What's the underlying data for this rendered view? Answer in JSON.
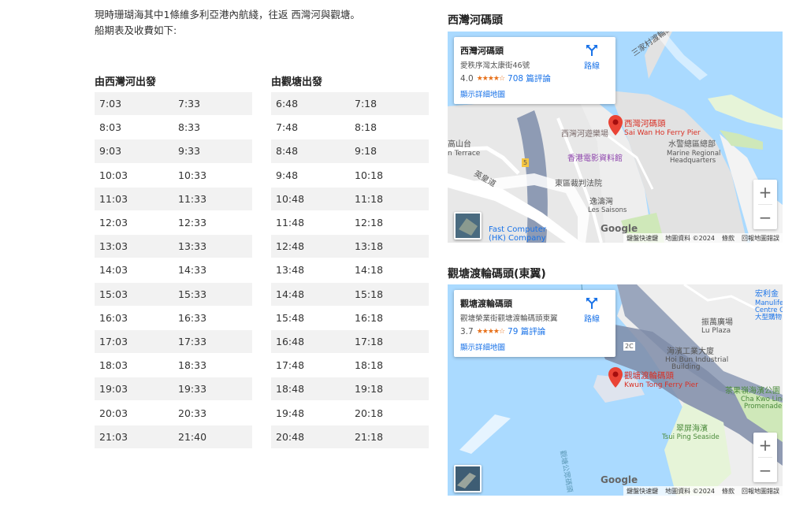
{
  "intro": {
    "line1": "現時珊瑚海其中1條維多利亞港內航綫，往返 西灣河與觀塘。",
    "line2": "船期表及收費如下:"
  },
  "schedule": {
    "from_sai_wan_ho": {
      "title": "由西灣河出發",
      "rows": [
        [
          "7:03",
          "7:33"
        ],
        [
          "8:03",
          "8:33"
        ],
        [
          "9:03",
          "9:33"
        ],
        [
          "10:03",
          "10:33"
        ],
        [
          "11:03",
          "11:33"
        ],
        [
          "12:03",
          "12:33"
        ],
        [
          "13:03",
          "13:33"
        ],
        [
          "14:03",
          "14:33"
        ],
        [
          "15:03",
          "15:33"
        ],
        [
          "16:03",
          "16:33"
        ],
        [
          "17:03",
          "17:33"
        ],
        [
          "18:03",
          "18:33"
        ],
        [
          "19:03",
          "19:33"
        ],
        [
          "20:03",
          "20:33"
        ],
        [
          "21:03",
          "21:40"
        ]
      ]
    },
    "from_kwun_tong": {
      "title": "由觀塘出發",
      "rows": [
        [
          "6:48",
          "7:18"
        ],
        [
          "7:48",
          "8:18"
        ],
        [
          "8:48",
          "9:18"
        ],
        [
          "9:48",
          "10:18"
        ],
        [
          "10:48",
          "11:18"
        ],
        [
          "11:48",
          "12:18"
        ],
        [
          "12:48",
          "13:18"
        ],
        [
          "13:48",
          "14:18"
        ],
        [
          "14:48",
          "15:18"
        ],
        [
          "15:48",
          "16:18"
        ],
        [
          "16:48",
          "17:18"
        ],
        [
          "17:48",
          "18:18"
        ],
        [
          "18:48",
          "19:18"
        ],
        [
          "19:48",
          "20:18"
        ],
        [
          "20:48",
          "21:18"
        ]
      ]
    }
  },
  "map1": {
    "heading": "西灣河碼頭",
    "card": {
      "name": "西灣河碼頭",
      "address": "愛秩序灣太康街46號",
      "rating": "4.0",
      "stars": "★★★★☆",
      "reviews": "708 篇評論",
      "larger_map": "顯示詳細地圖",
      "directions": "路線"
    },
    "labels": {
      "pier_zh": "西灣河碼頭",
      "pier_en": "Sai Wan Ho Ferry Pier",
      "marine_zh": "水警總區總部",
      "marine_en1": "Marine Regional",
      "marine_en2": "Headquarters",
      "playground": "西灣河遊樂場",
      "film_archive": "香港電影資料館",
      "court": "東區裁判法院",
      "les_saisons_zh": "逸濤灣",
      "les_saisons_en": "Les Saisons",
      "fast_computer_1": "Fast Computer",
      "fast_computer_2": "(HK) Company",
      "kwong_ming": "高山台",
      "terrace": "n Terrace",
      "ying_wong": "英皇道",
      "sam_ka": "三家村渡輪碼頭",
      "road_num": "5"
    },
    "google": "Google",
    "attribution": [
      "鍵盤快速鍵",
      "地圖資料 ©2024",
      "條款",
      "回報地圖錯誤"
    ],
    "zoom_in": "+",
    "zoom_out": "−"
  },
  "map2": {
    "heading": "觀塘渡輪碼頭(東翼)",
    "card": {
      "name": "觀塘渡輪碼頭",
      "address": "觀塘榮業街觀塘渡輪碼頭東翼",
      "rating": "3.7",
      "stars": "★★★★☆",
      "reviews": "79 篇評論",
      "larger_map": "顯示詳細地圖",
      "directions": "路線"
    },
    "labels": {
      "pier_zh": "觀塘渡輪碼頭",
      "pier_en": "Kwun Tong Ferry Pier",
      "lu_plaza_zh": "振萬廣場",
      "lu_plaza_en": "Lu Plaza",
      "hoi_bun_zh": "海濱工業大廈",
      "hoi_bun_en1": "Hoi Bun Industrial",
      "hoi_bun_en2": "Building",
      "manulife_zh": "宏利金",
      "manulife_en1": "Manulife",
      "manulife_en2": "Centre Co",
      "manulife_en3": "大型購物",
      "promenade_zh": "茶果嶺海濱公園",
      "promenade_en1": "Cha Kwo Ling",
      "promenade_en2": "Promenade",
      "tsui_ping_zh": "翠屏海濱",
      "tsui_ping_en": "Tsui Ping Seaside",
      "airport_road": "觀塘公眾碼頭",
      "road_2c": "2C"
    },
    "google": "Google",
    "attribution": [
      "鍵盤快速鍵",
      "地圖資料 ©2024",
      "條款",
      "回報地圖錯誤"
    ],
    "zoom_in": "+",
    "zoom_out": "−"
  },
  "colors": {
    "water": "#aadaff",
    "land": "#f0f0f0",
    "pier_red": "#d93025",
    "link_blue": "#1a73e8",
    "star_orange": "#e7711b"
  }
}
